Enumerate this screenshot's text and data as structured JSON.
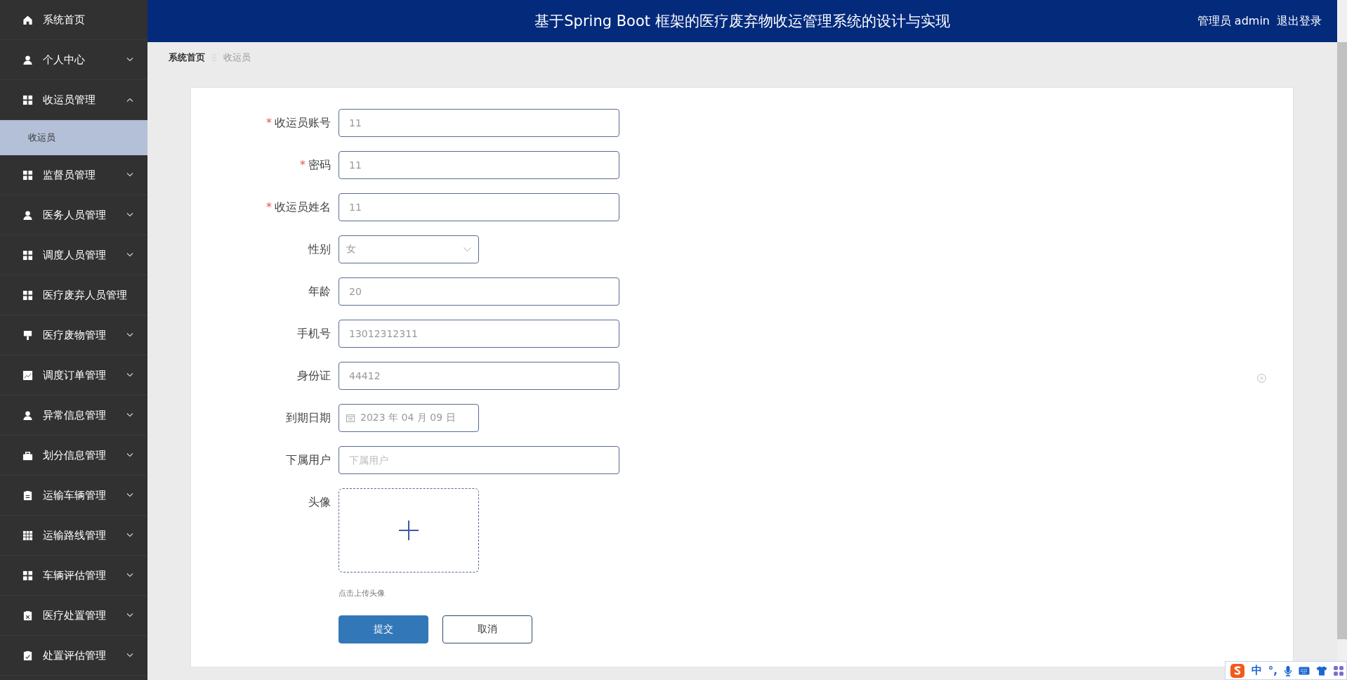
{
  "sidebar": {
    "items": [
      {
        "label": "系统首页"
      },
      {
        "label": "个人中心",
        "expanded": false
      },
      {
        "label": "收运员管理",
        "expanded": true,
        "children": [
          {
            "label": "收运员",
            "selected": true
          }
        ]
      },
      {
        "label": "监督员管理",
        "expanded": false
      },
      {
        "label": "医务人员管理",
        "expanded": false
      },
      {
        "label": "调度人员管理",
        "expanded": false
      },
      {
        "label": "医疗废弃人员管理"
      },
      {
        "label": "医疗废物管理",
        "expanded": false
      },
      {
        "label": "调度订单管理",
        "expanded": false
      },
      {
        "label": "异常信息管理",
        "expanded": false
      },
      {
        "label": "划分信息管理",
        "expanded": false
      },
      {
        "label": "运输车辆管理",
        "expanded": false
      },
      {
        "label": "运输路线管理",
        "expanded": false
      },
      {
        "label": "车辆评估管理",
        "expanded": false
      },
      {
        "label": "医疗处置管理",
        "expanded": false
      },
      {
        "label": "处置评估管理",
        "expanded": false
      }
    ]
  },
  "header": {
    "title": "基于Spring Boot 框架的医疗废弃物收运管理系统的设计与实现",
    "user": "管理员 admin",
    "logout": "退出登录"
  },
  "breadcrumb": [
    {
      "label": "系统首页"
    },
    {
      "label": "收运员"
    }
  ],
  "form": {
    "required_mark": "*",
    "fields": [
      {
        "kind": "text",
        "label": "收运员账号",
        "required": true,
        "value": "11"
      },
      {
        "kind": "text",
        "label": "密码",
        "required": true,
        "value": "11"
      },
      {
        "kind": "text",
        "label": "收运员姓名",
        "required": true,
        "value": "11"
      },
      {
        "kind": "select",
        "label": "性别",
        "required": false,
        "value": "女"
      },
      {
        "kind": "text",
        "label": "年龄",
        "required": false,
        "value": "20"
      },
      {
        "kind": "text",
        "label": "手机号",
        "required": false,
        "value": "13012312311"
      },
      {
        "kind": "text",
        "label": "身份证",
        "required": false,
        "value": "44412"
      },
      {
        "kind": "date",
        "label": "到期日期",
        "required": false,
        "value": "2023 年 04 月 09 日"
      },
      {
        "kind": "text",
        "label": "下属用户",
        "required": false,
        "placeholder": "下属用户"
      },
      {
        "kind": "upload",
        "label": "头像",
        "required": false,
        "hint": "点击上传头像"
      }
    ],
    "buttons": [
      {
        "label": "提交",
        "kind": "primary"
      },
      {
        "label": "取消",
        "kind": "default"
      }
    ]
  },
  "ime_toolbar": {
    "mode": "中",
    "punctuation": "°,"
  }
}
